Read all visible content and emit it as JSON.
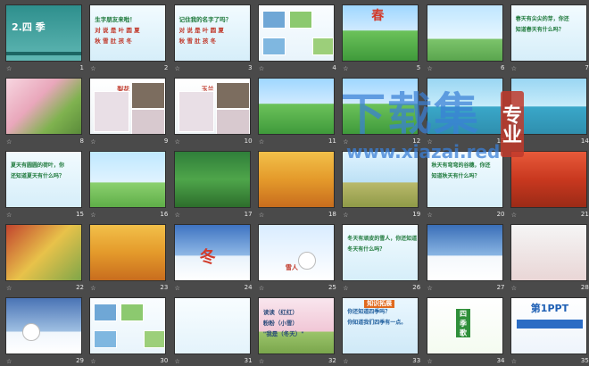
{
  "slides": [
    {
      "n": "1",
      "kind": "title",
      "title": "2.四 季"
    },
    {
      "n": "2",
      "kind": "text",
      "lines": [
        "生字朋友来啦！",
        "对 说 是 叶 圆 夏",
        "秋 雪 肚 孩 冬"
      ]
    },
    {
      "n": "3",
      "kind": "text",
      "lines": [
        "记住我的名字了吗？",
        "对 说 是 叶 圆 夏",
        "秋 雪 肚 孩 冬"
      ]
    },
    {
      "n": "4",
      "kind": "collage"
    },
    {
      "n": "5",
      "kind": "spring",
      "word": "春"
    },
    {
      "n": "6",
      "kind": "bird"
    },
    {
      "n": "7",
      "kind": "text",
      "lines": [
        "春天有尖尖的芽，你还",
        "知道春天有什么吗？"
      ]
    },
    {
      "n": "8",
      "kind": "blossom"
    },
    {
      "n": "9",
      "kind": "flowers",
      "label": "梨花"
    },
    {
      "n": "10",
      "kind": "flowers",
      "label": "玉兰"
    },
    {
      "n": "11",
      "kind": "spring"
    },
    {
      "n": "12",
      "kind": "spring"
    },
    {
      "n": "13",
      "kind": "lake"
    },
    {
      "n": "14",
      "kind": "lake"
    },
    {
      "n": "15",
      "kind": "text",
      "lines": [
        "夏天有圆圆的荷叶，你",
        "还知道夏天有什么吗？"
      ]
    },
    {
      "n": "16",
      "kind": "kids"
    },
    {
      "n": "17",
      "kind": "lotus"
    },
    {
      "n": "18",
      "kind": "autumn"
    },
    {
      "n": "19",
      "kind": "wheat"
    },
    {
      "n": "20",
      "kind": "text",
      "lines": [
        "秋天有弯弯的谷穗，你还",
        "知道秋天有什么吗？"
      ]
    },
    {
      "n": "21",
      "kind": "red"
    },
    {
      "n": "22",
      "kind": "fruit"
    },
    {
      "n": "23",
      "kind": "autumn"
    },
    {
      "n": "24",
      "kind": "winter",
      "word": "冬"
    },
    {
      "n": "25",
      "kind": "snowman",
      "label": "雪人"
    },
    {
      "n": "26",
      "kind": "text",
      "lines": [
        "冬天有顽皮的雪人，你还知道",
        "冬天有什么吗？"
      ]
    },
    {
      "n": "27",
      "kind": "snowtree"
    },
    {
      "n": "28",
      "kind": "redsnow"
    },
    {
      "n": "29",
      "kind": "snowman2"
    },
    {
      "n": "30",
      "kind": "collage"
    },
    {
      "n": "31",
      "kind": "pinyin"
    },
    {
      "n": "32",
      "kind": "pink",
      "lines": [
        "读读（红红）",
        "粉粉（小雪）",
        "\"我是（冬天）\""
      ]
    },
    {
      "n": "33",
      "kind": "ext",
      "title": "知识拓展",
      "lines": [
        "你还知道四季吗？",
        "你知道我们四季有一点。"
      ]
    },
    {
      "n": "34",
      "kind": "poem",
      "title": "四 季 歌"
    },
    {
      "n": "35",
      "kind": "ppt",
      "title": "第1PPT"
    }
  ],
  "watermark": {
    "main": "下载集",
    "brand": "专业",
    "url": "www.xiazai.red"
  },
  "colors": {
    "bg": "#4a4a4a",
    "wm_blue": "#3a7fd6",
    "wm_red": "#c0392b"
  }
}
